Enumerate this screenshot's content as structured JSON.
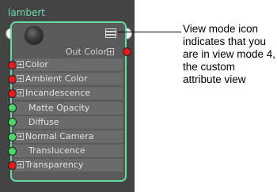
{
  "node": {
    "title": "lambert",
    "output_label": "Out Color",
    "viewmode_icon": "view-mode-icon",
    "attributes": [
      {
        "label": "Color",
        "expandable": true,
        "port": "red"
      },
      {
        "label": "Ambient Color",
        "expandable": true,
        "port": "red"
      },
      {
        "label": "Incandescence",
        "expandable": true,
        "port": "red"
      },
      {
        "label": "Matte Opacity",
        "expandable": false,
        "port": "green"
      },
      {
        "label": "Diffuse",
        "expandable": false,
        "port": "green"
      },
      {
        "label": "Normal Camera",
        "expandable": true,
        "port": "green"
      },
      {
        "label": "Translucence",
        "expandable": false,
        "port": "green"
      },
      {
        "label": "Transparency",
        "expandable": true,
        "port": "red"
      }
    ]
  },
  "callout": {
    "text": "View mode icon indicates that you are in view mode 4, the custom attribute view"
  },
  "colors": {
    "node_border": "#62d9a3",
    "title": "#6fd9a6",
    "port_red": "#e01c1c",
    "port_green": "#49d86a"
  }
}
